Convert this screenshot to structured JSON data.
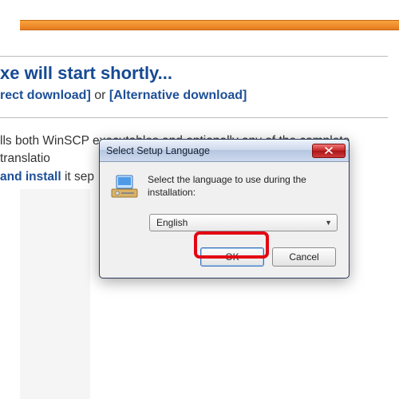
{
  "page": {
    "headline": "xe will start shortly...",
    "direct": "rect download]",
    "or": " or ",
    "alt": "[Alternative download]",
    "para_before_app": "lls both WinSCP ",
    "para_cutword": "executables and optionally any of the complete translatio",
    "para_link": "and install",
    "para_after_link": " it sep"
  },
  "dialog": {
    "title": "Select Setup Language",
    "message": "Select the language to use during the installation:",
    "language": "English",
    "ok": "OK",
    "cancel": "Cancel"
  }
}
